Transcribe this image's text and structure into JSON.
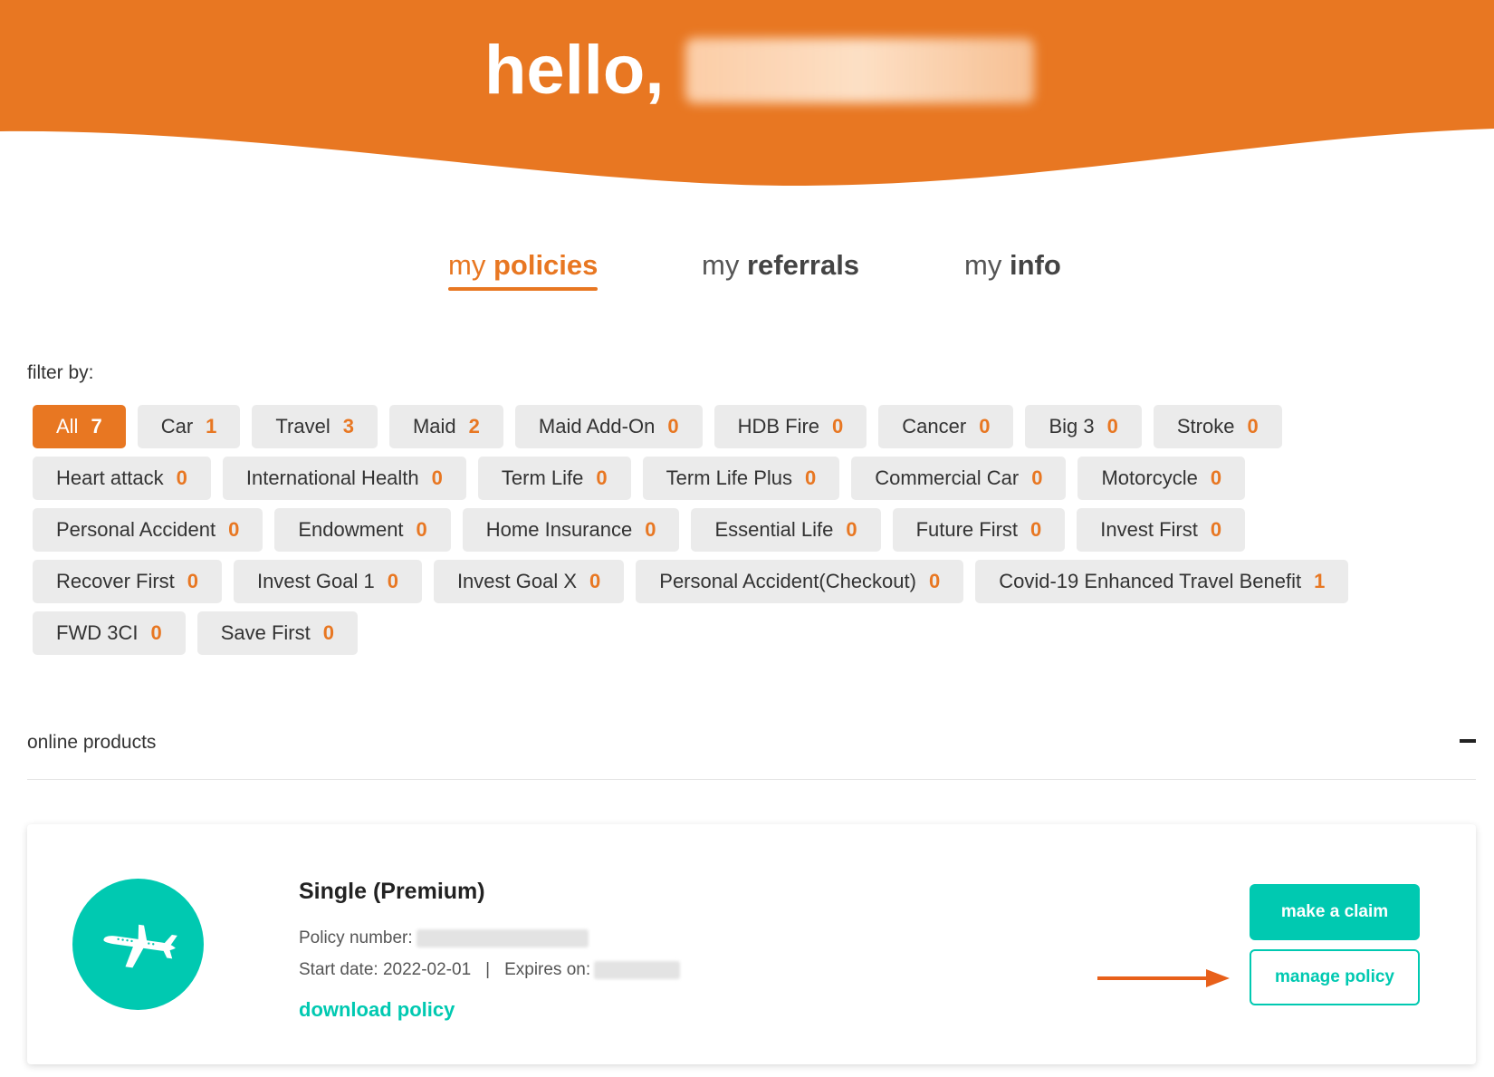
{
  "theme": {
    "accent": "#e87722",
    "teal": "#00c9b1",
    "chip_bg": "#ebebeb"
  },
  "header": {
    "greeting": "hello,"
  },
  "tabs": [
    {
      "prefix": "my",
      "label": "policies",
      "active": true
    },
    {
      "prefix": "my",
      "label": "referrals",
      "active": false
    },
    {
      "prefix": "my",
      "label": "info",
      "active": false
    }
  ],
  "filter": {
    "label": "filter by:",
    "chips": [
      {
        "label": "All",
        "count": "7",
        "active": true
      },
      {
        "label": "Car",
        "count": "1"
      },
      {
        "label": "Travel",
        "count": "3"
      },
      {
        "label": "Maid",
        "count": "2"
      },
      {
        "label": "Maid Add-On",
        "count": "0"
      },
      {
        "label": "HDB Fire",
        "count": "0"
      },
      {
        "label": "Cancer",
        "count": "0"
      },
      {
        "label": "Big 3",
        "count": "0"
      },
      {
        "label": "Stroke",
        "count": "0"
      },
      {
        "label": "Heart attack",
        "count": "0"
      },
      {
        "label": "International Health",
        "count": "0"
      },
      {
        "label": "Term Life",
        "count": "0"
      },
      {
        "label": "Term Life Plus",
        "count": "0"
      },
      {
        "label": "Commercial Car",
        "count": "0"
      },
      {
        "label": "Motorcycle",
        "count": "0"
      },
      {
        "label": "Personal Accident",
        "count": "0"
      },
      {
        "label": "Endowment",
        "count": "0"
      },
      {
        "label": "Home Insurance",
        "count": "0"
      },
      {
        "label": "Essential Life",
        "count": "0"
      },
      {
        "label": "Future First",
        "count": "0"
      },
      {
        "label": "Invest First",
        "count": "0"
      },
      {
        "label": "Recover First",
        "count": "0"
      },
      {
        "label": "Invest Goal 1",
        "count": "0"
      },
      {
        "label": "Invest Goal X",
        "count": "0"
      },
      {
        "label": "Personal Accident(Checkout)",
        "count": "0"
      },
      {
        "label": "Covid-19 Enhanced Travel Benefit",
        "count": "1"
      },
      {
        "label": "FWD 3CI",
        "count": "0"
      },
      {
        "label": "Save First",
        "count": "0"
      }
    ]
  },
  "section": {
    "title": "online products"
  },
  "policy": {
    "icon": "airplane-icon",
    "title": "Single (Premium)",
    "number_label": "Policy number:",
    "start_label": "Start date: 2022-02-01",
    "separator": "|",
    "expires_label": "Expires on:",
    "download_label": "download policy",
    "claim_label": "make a claim",
    "manage_label": "manage policy"
  }
}
